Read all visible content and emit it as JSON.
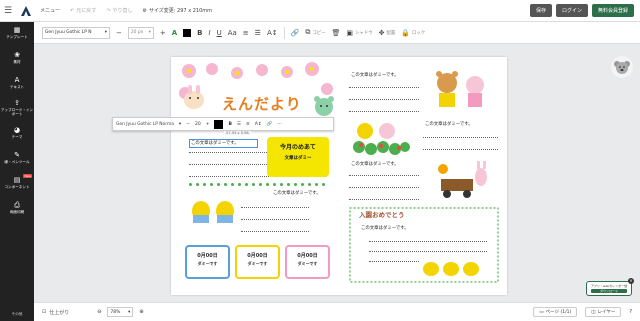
{
  "topbar": {
    "menu_label": "メニュー",
    "undo_label": "元に戻す",
    "redo_label": "やり直し",
    "size_label": "サイズ変更: 297 x 210mm",
    "save_label": "保存",
    "login_label": "ログイン",
    "member_label": "無料会員登録"
  },
  "sidebar": {
    "items": [
      {
        "label": "テンプレート",
        "icon": "template-icon"
      },
      {
        "label": "素材",
        "icon": "flower-icon"
      },
      {
        "label": "テキスト",
        "icon": "text-icon"
      },
      {
        "label": "アップロード・インポート",
        "icon": "upload-icon"
      },
      {
        "label": "テーマ",
        "icon": "palette-icon"
      },
      {
        "label": "線・ペンツール",
        "icon": "pen-icon"
      },
      {
        "label": "コンポーネント",
        "icon": "component-icon"
      },
      {
        "label": "両面印刷",
        "icon": "print-icon"
      }
    ],
    "new_badge": "New",
    "bottom_label": "その他"
  },
  "toolbar": {
    "font": "Gen Jyuu Gothic LP N",
    "size_placeholder": "20 px",
    "copy_label": "コピー",
    "shadow_label": "シャドウ",
    "arrange_label": "配置",
    "lock_label": "ロック"
  },
  "float_toolbar": {
    "font": "Gen Jyuu Gothic LP Norma",
    "size": "20",
    "size_tip": "57.93 x 5.96"
  },
  "page": {
    "headline": "えんだより",
    "goal_title": "今月のめあて",
    "goal_text": "文章はダミー",
    "section_title": "入園おめでとう",
    "dummy": "この文章はダミーです。",
    "cards": [
      {
        "date": "0月00日",
        "text": "ダミーです",
        "color": "#5aa0d8"
      },
      {
        "date": "0月00日",
        "text": "ダミーです",
        "color": "#f4d400"
      },
      {
        "date": "0月00日",
        "text": "ダミーです",
        "color": "#f49ac1"
      }
    ]
  },
  "bottombar": {
    "finish_label": "仕上がり",
    "zoom": "78%",
    "page_label": "ページ (1/1)",
    "layer_label": "レイヤー"
  },
  "ad": {
    "text": "アプリ・webカレンダー他",
    "button": "ダウンロード"
  }
}
